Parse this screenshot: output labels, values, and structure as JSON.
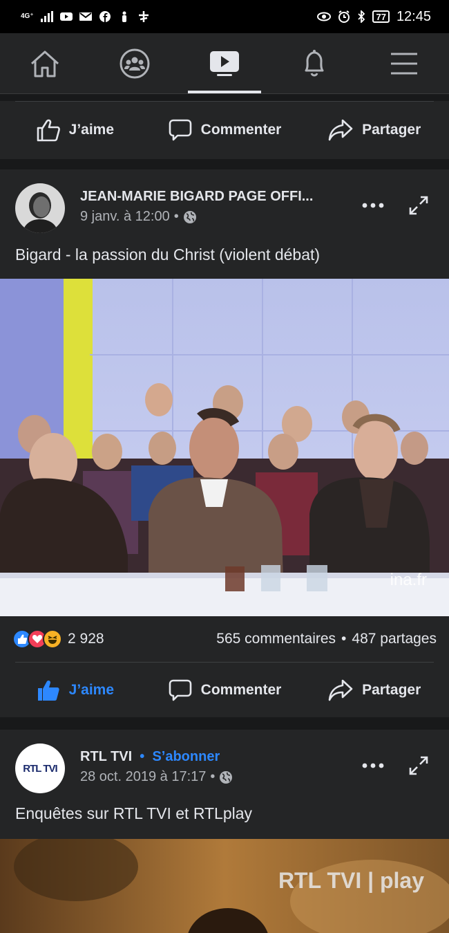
{
  "status_bar": {
    "network": "4G⁺",
    "battery": "77",
    "time": "12:45"
  },
  "nav": {
    "items": [
      "home-icon",
      "groups-icon",
      "watch-icon",
      "notifications-icon",
      "menu-icon"
    ]
  },
  "actions": {
    "like": "J’aime",
    "comment": "Commenter",
    "share": "Partager"
  },
  "post1": {
    "page_name": "JEAN-MARIE BIGARD PAGE  OFFI...",
    "date": "9 janv. à 12:00",
    "caption": "Bigard - la passion du Christ (violent débat)",
    "video_watermark": "ina.fr",
    "reaction_count": "2 928",
    "comments": "565 commentaires",
    "shares": "487 partages"
  },
  "post2": {
    "page_name": "RTL TVI",
    "follow": "S’abonner",
    "date": "28 oct. 2019 à 17:17",
    "caption": "Enquêtes sur RTL TVI et RTLplay",
    "avatar_logo": "RTL TVI",
    "video_watermark": "RTL TVI | play"
  },
  "colors": {
    "bg": "#18191a",
    "card": "#242526",
    "accent": "#2d88ff",
    "text": "#e4e6eb",
    "muted": "#b0b3b8"
  }
}
